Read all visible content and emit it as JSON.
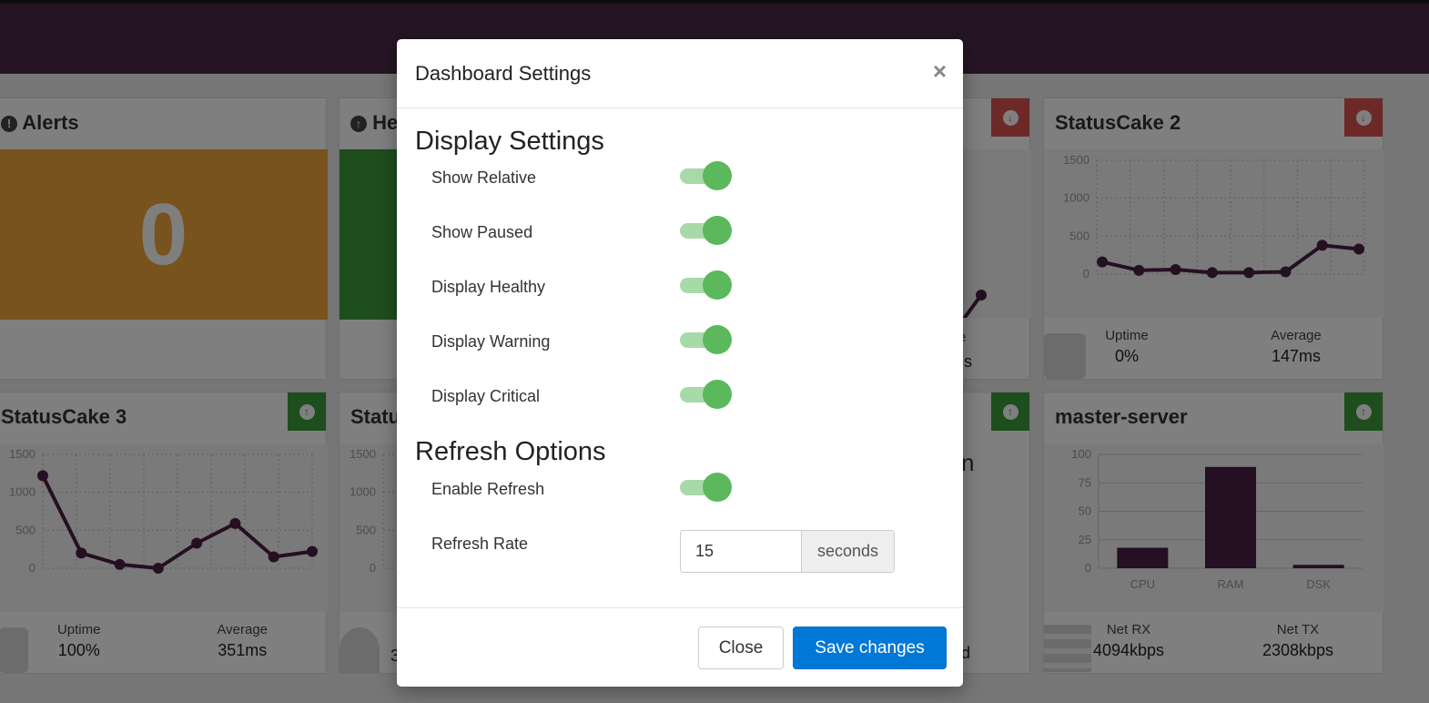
{
  "dashboard": {
    "alerts": {
      "title": "Alerts",
      "value": "0"
    },
    "healthy": {
      "title": "He"
    },
    "statuscake1": {
      "uptime_label": "e",
      "average_value": "s"
    },
    "statuscake2": {
      "title": "StatusCake 2",
      "y_ticks": [
        "1500",
        "1000",
        "500",
        "0"
      ],
      "uptime_label": "Uptime",
      "uptime_value": "0%",
      "average_label": "Average",
      "average_value": "147ms"
    },
    "statuscake3": {
      "title": "StatusCake 3",
      "y_ticks": [
        "1500",
        "1000",
        "500",
        "0"
      ],
      "uptime_label": "Uptime",
      "uptime_value": "100%",
      "average_label": "Average",
      "average_value": "351ms"
    },
    "statuscake4": {
      "title": "Statu",
      "y_ticks": [
        "1500",
        "1000",
        "500",
        "0"
      ],
      "uptime_value": "3"
    },
    "hidden_panel": {
      "text_fragment": "n",
      "value_fragment": "d"
    },
    "master_server": {
      "title": "master-server",
      "y_ticks": [
        "100",
        "75",
        "50",
        "25",
        "0"
      ],
      "netrx_label": "Net RX",
      "netrx_value": "4094kbps",
      "nettx_label": "Net TX",
      "nettx_value": "2308kbps"
    }
  },
  "chart_data": [
    {
      "type": "line",
      "title": "StatusCake 2",
      "x": [
        1,
        2,
        3,
        4,
        5,
        6,
        7,
        8
      ],
      "values": [
        160,
        50,
        60,
        20,
        20,
        30,
        380,
        330
      ],
      "ylim": [
        0,
        1500
      ]
    },
    {
      "type": "line",
      "title": "StatusCake 3",
      "x": [
        1,
        2,
        3,
        4,
        5,
        6,
        7,
        8
      ],
      "values": [
        1220,
        200,
        50,
        0,
        330,
        590,
        150,
        220
      ],
      "ylim": [
        0,
        1500
      ]
    },
    {
      "type": "bar",
      "title": "master-server",
      "categories": [
        "CPU",
        "RAM",
        "DSK"
      ],
      "values": [
        18,
        89,
        3
      ],
      "ylim": [
        0,
        100
      ]
    }
  ],
  "modal": {
    "title": "Dashboard Settings",
    "close_symbol": "×",
    "display_section_title": "Display Settings",
    "display_settings": [
      {
        "label": "Show Relative",
        "enabled": true
      },
      {
        "label": "Show Paused",
        "enabled": true
      },
      {
        "label": "Display Healthy",
        "enabled": true
      },
      {
        "label": "Display Warning",
        "enabled": true
      },
      {
        "label": "Display Critical",
        "enabled": true
      }
    ],
    "refresh_section_title": "Refresh Options",
    "enable_refresh_label": "Enable Refresh",
    "enable_refresh": true,
    "refresh_rate_label": "Refresh Rate",
    "refresh_rate_value": "15",
    "refresh_rate_unit": "seconds",
    "close_button": "Close",
    "save_button": "Save changes"
  },
  "colors": {
    "topbar": "#4a2a4a",
    "alert_tile": "#f0a73a",
    "healthy_tile": "#3c9a3c",
    "chart_series": "#4a1e45",
    "toggle_on": "#5cb85c",
    "primary_button": "#0078d7",
    "badge_down": "#d9534f",
    "badge_up": "#3c9a3c"
  },
  "icons": {
    "alerts_title_icon": "exclamation-circle-icon",
    "healthy_title_icon": "arrow-up-circle-icon",
    "badge_down_icon": "arrow-down-circle-icon",
    "badge_up_icon": "arrow-up-circle-icon"
  }
}
